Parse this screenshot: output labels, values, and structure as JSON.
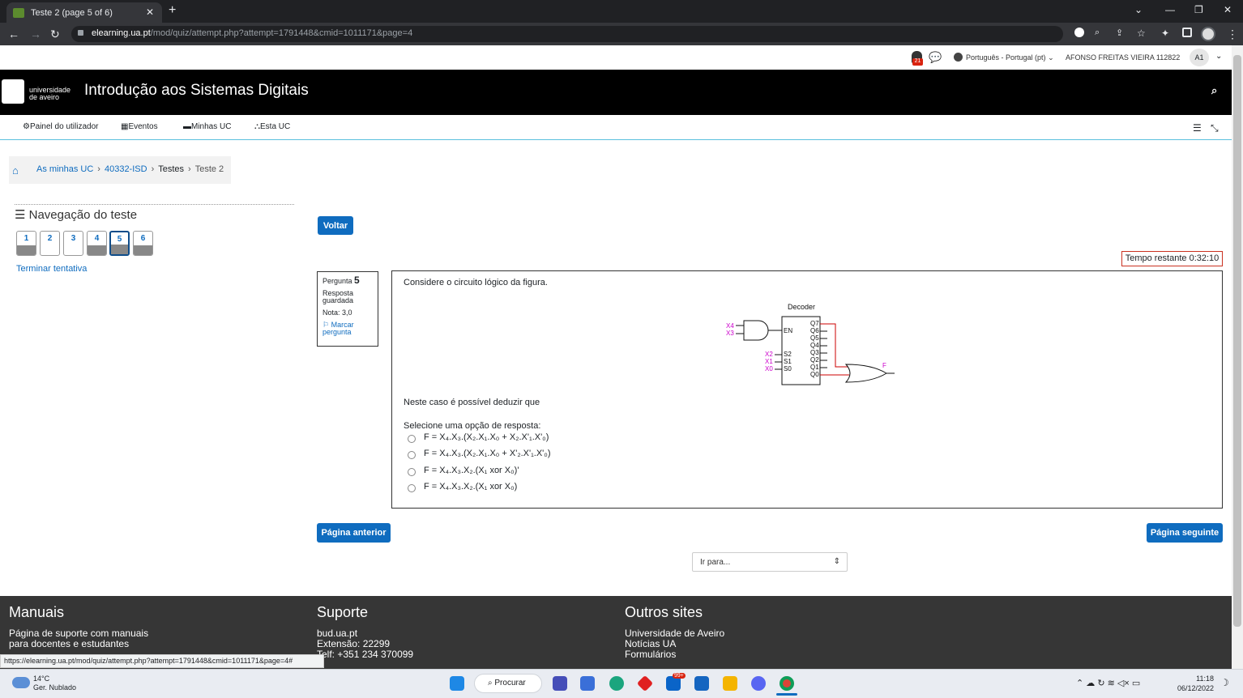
{
  "browser": {
    "tab_title": "Teste 2 (page 5 of 6)",
    "url_host": "elearning.ua.pt",
    "url_path": "/mod/quiz/attempt.php?attempt=1791448&cmid=1011171&page=4",
    "status_url": "https://elearning.ua.pt/mod/quiz/attempt.php?attempt=1791448&cmid=1011171&page=4#"
  },
  "userbar": {
    "notif_count": "21",
    "language": "Português - Portugal (pt)",
    "user_name": "AFONSO FREITAS VIEIRA 112822",
    "user_initials": "A1"
  },
  "header": {
    "logo_line1": "universidade",
    "logo_line2": "de aveiro",
    "site_title": "Introdução aos Sistemas Digitais"
  },
  "nav": {
    "items": [
      "Painel do utilizador",
      "Eventos",
      "Minhas UC",
      "Esta UC"
    ]
  },
  "breadcrumb": {
    "items": [
      "As minhas UC",
      "40332-ISD",
      "Testes",
      "Teste 2"
    ]
  },
  "quiz_nav": {
    "title": "Navegação do teste",
    "questions": [
      "1",
      "2",
      "3",
      "4",
      "5",
      "6"
    ],
    "finish_label": "Terminar tentativa"
  },
  "buttons": {
    "back": "Voltar",
    "prev": "Página anterior",
    "next": "Página seguinte",
    "jump": "Ir para..."
  },
  "timer": {
    "label": "Tempo restante 0:32:10"
  },
  "question": {
    "label": "Pergunta",
    "number": "5",
    "state": "Resposta guardada",
    "grade": "Nota: 3,0",
    "flag": "Marcar pergunta",
    "intro": "Considere o circuito lógico da figura.",
    "prompt": "Neste caso é possível deduzir que",
    "select_label": "Selecione uma opção de resposta:",
    "options": [
      "F = X₄.X₃.(X₂.X₁.X₀ + X₂.X'₁.X'₀)",
      "F = X₄.X₃.(X₂.X₁.X₀ + X'₂.X'₁.X'₀)",
      "F = X₄.X₃.X₂.(X₁ xor X₀)'",
      "F = X₄.X₃.X₂.(X₁ xor X₀)"
    ]
  },
  "circuit": {
    "title": "Decoder",
    "en": "EN",
    "and_inputs": [
      "X4",
      "X3"
    ],
    "sel_inputs": [
      "X2",
      "X1",
      "X0"
    ],
    "sel_labels": [
      "S2",
      "S1",
      "S0"
    ],
    "outputs": [
      "Q7",
      "Q6",
      "Q5",
      "Q4",
      "Q3",
      "Q2",
      "Q1",
      "Q0"
    ],
    "out_label": "F"
  },
  "footer": {
    "col1_title": "Manuais",
    "col1_lines": [
      "Página de suporte com manuais",
      "para docentes e estudantes"
    ],
    "col2_title": "Suporte",
    "col2_lines": [
      "bud.ua.pt",
      "Extensão: 22299",
      "Telf: +351 234 370099"
    ],
    "col3_title": "Outros sites",
    "col3_lines": [
      "Universidade de Aveiro",
      "Notícias UA",
      "Formulários"
    ]
  },
  "taskbar": {
    "temp": "14°C",
    "weather": "Ger. Nublado",
    "search": "Procurar",
    "badge": "99+",
    "time": "11:18",
    "date": "06/12/2022"
  },
  "colors": {
    "accent": "#0f6cbf",
    "header_bg": "#000000",
    "footer_bg": "#363636",
    "timer_border": "#ca3120",
    "circuit_highlight": "#cc00cc",
    "circuit_wire": "#cc0000"
  }
}
